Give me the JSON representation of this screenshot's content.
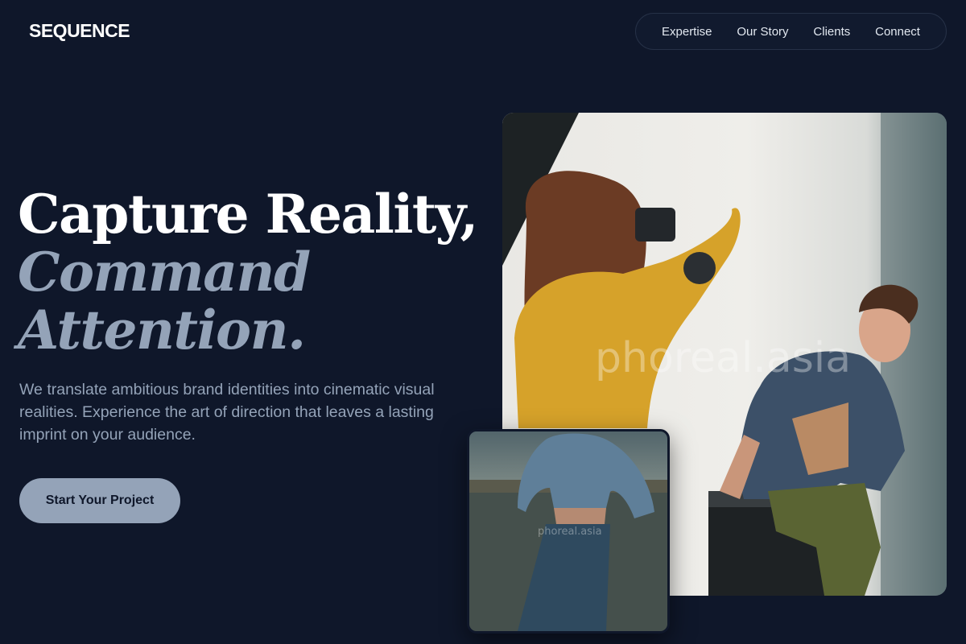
{
  "brand": {
    "logo": "SEQUENCE"
  },
  "nav": {
    "items": [
      {
        "label": "Expertise"
      },
      {
        "label": "Our Story"
      },
      {
        "label": "Clients"
      },
      {
        "label": "Connect"
      }
    ]
  },
  "hero": {
    "headline_line1": "Capture Reality,",
    "headline_line2": "Command",
    "headline_line3": "Attention.",
    "subtext": "We translate ambitious brand identities into cinematic visual realities. Experience the art of direction that leaves a lasting imprint on your audience.",
    "cta_label": "Start Your Project"
  },
  "images": {
    "main_watermark": "phoreal.asia",
    "small_watermark": "phoreal.asia"
  },
  "colors": {
    "background": "#0f172a",
    "accent": "#94a3b8",
    "heading": "#ffffff"
  }
}
